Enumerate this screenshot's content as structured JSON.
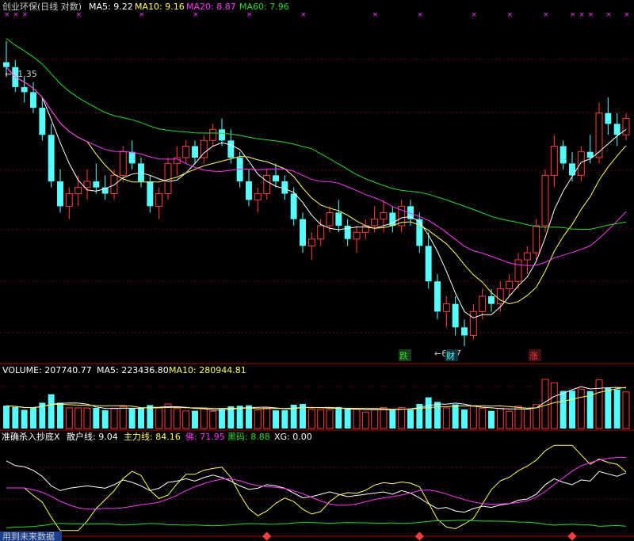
{
  "colors": {
    "background": "#000000",
    "up": "#ff3c3c",
    "down": "#54ffff",
    "ma5": "#ffffff",
    "ma10": "#ffff55",
    "ma20": "#ff33ff",
    "ma60": "#22dd22",
    "grid": "#7a0000",
    "title": "#cccccc"
  },
  "price_panel": {
    "title_stock": "创业环保(日线 对数)",
    "ma_legend": [
      {
        "label": "MA5: 9.22",
        "color": "#ffffff"
      },
      {
        "label": "MA10: 9.16",
        "color": "#ffff55"
      },
      {
        "label": "MA20: 8.87",
        "color": "#ff33ff"
      },
      {
        "label": "MA60: 7.96",
        "color": "#22dd22"
      }
    ],
    "high_marker": "11.35",
    "low_marker": "6.37",
    "signals": [
      {
        "text": "跌",
        "color": "#22dd22"
      },
      {
        "text": "财",
        "color": "#54ffff"
      },
      {
        "text": "涨",
        "color": "#ff3c3c"
      }
    ]
  },
  "volume_panel": {
    "legend": [
      {
        "label": "VOLUME: 207740.77",
        "color": "#ffffff"
      },
      {
        "label": "MA5: 223436.80",
        "color": "#ffffff"
      },
      {
        "label": "MA10: 280944.81",
        "color": "#ffff55"
      }
    ]
  },
  "indicator_panel": {
    "legend": [
      {
        "label": "准确杀入抄底X",
        "color": "#ffffff"
      },
      {
        "label": "散户线: 9.04",
        "color": "#ffffff"
      },
      {
        "label": "主力线: 84.16",
        "color": "#ffff55"
      },
      {
        "label": "佛: 71.95",
        "color": "#ff33ff"
      },
      {
        "label": "黑码: 8.88",
        "color": "#22dd22"
      },
      {
        "label": "XG: 0.00",
        "color": "#ffffff"
      }
    ]
  },
  "footer_text": "用到未来数据",
  "chart_data": {
    "type": "candlestick",
    "title": "创业环保(日线 对数)",
    "ma_periods": [
      5,
      10,
      20,
      60
    ],
    "ma_latest": {
      "MA5": 9.22,
      "MA10": 9.16,
      "MA20": 8.87,
      "MA60": 7.96
    },
    "price_range": [
      6.2,
      11.9
    ],
    "high_label": 11.35,
    "low_label": 6.37,
    "candles_ohlc": [
      [
        10.9,
        11.35,
        10.6,
        10.8
      ],
      [
        10.8,
        10.95,
        10.3,
        10.4
      ],
      [
        10.4,
        10.6,
        10.1,
        10.3
      ],
      [
        10.3,
        10.5,
        9.9,
        10.0
      ],
      [
        10.0,
        10.2,
        9.4,
        9.5
      ],
      [
        9.5,
        9.7,
        8.6,
        8.7
      ],
      [
        8.7,
        8.9,
        8.2,
        8.3
      ],
      [
        8.3,
        8.6,
        8.1,
        8.5
      ],
      [
        8.5,
        8.8,
        8.3,
        8.6
      ],
      [
        8.6,
        8.9,
        8.4,
        8.7
      ],
      [
        8.7,
        9.0,
        8.5,
        8.6
      ],
      [
        8.6,
        8.8,
        8.4,
        8.5
      ],
      [
        8.5,
        8.9,
        8.4,
        8.8
      ],
      [
        8.8,
        9.3,
        8.7,
        9.2
      ],
      [
        9.2,
        9.4,
        8.9,
        9.0
      ],
      [
        9.0,
        9.1,
        8.6,
        8.7
      ],
      [
        8.7,
        8.8,
        8.2,
        8.3
      ],
      [
        8.3,
        8.6,
        8.1,
        8.5
      ],
      [
        8.5,
        9.1,
        8.4,
        9.0
      ],
      [
        9.0,
        9.3,
        8.8,
        9.1
      ],
      [
        9.1,
        9.4,
        9.0,
        9.3
      ],
      [
        9.3,
        9.4,
        9.0,
        9.1
      ],
      [
        9.1,
        9.5,
        9.0,
        9.4
      ],
      [
        9.4,
        9.7,
        9.3,
        9.6
      ],
      [
        9.6,
        9.8,
        9.3,
        9.4
      ],
      [
        9.4,
        9.6,
        9.0,
        9.1
      ],
      [
        9.1,
        9.2,
        8.6,
        8.7
      ],
      [
        8.7,
        8.9,
        8.3,
        8.4
      ],
      [
        8.4,
        8.6,
        8.2,
        8.5
      ],
      [
        8.5,
        8.9,
        8.4,
        8.8
      ],
      [
        8.8,
        9.0,
        8.6,
        8.7
      ],
      [
        8.7,
        8.8,
        8.4,
        8.5
      ],
      [
        8.5,
        8.6,
        8.0,
        8.1
      ],
      [
        8.1,
        8.2,
        7.6,
        7.7
      ],
      [
        7.7,
        7.9,
        7.5,
        7.8
      ],
      [
        7.8,
        8.1,
        7.7,
        8.0
      ],
      [
        8.0,
        8.3,
        7.9,
        8.2
      ],
      [
        8.2,
        8.4,
        7.9,
        8.0
      ],
      [
        8.0,
        8.1,
        7.7,
        7.8
      ],
      [
        7.8,
        8.0,
        7.6,
        7.9
      ],
      [
        7.9,
        8.1,
        7.8,
        8.0
      ],
      [
        8.0,
        8.3,
        7.9,
        8.1
      ],
      [
        8.1,
        8.4,
        7.9,
        8.2
      ],
      [
        8.2,
        8.3,
        7.9,
        8.0
      ],
      [
        8.0,
        8.4,
        7.9,
        8.3
      ],
      [
        8.3,
        8.4,
        8.0,
        8.1
      ],
      [
        8.1,
        8.2,
        7.6,
        7.7
      ],
      [
        7.7,
        7.9,
        7.1,
        7.2
      ],
      [
        7.2,
        7.3,
        6.7,
        6.8
      ],
      [
        6.8,
        7.0,
        6.6,
        6.9
      ],
      [
        6.9,
        7.0,
        6.5,
        6.6
      ],
      [
        6.6,
        6.7,
        6.37,
        6.5
      ],
      [
        6.5,
        6.9,
        6.45,
        6.8
      ],
      [
        6.8,
        7.1,
        6.7,
        7.0
      ],
      [
        7.0,
        7.1,
        6.8,
        6.9
      ],
      [
        6.9,
        7.2,
        6.8,
        7.1
      ],
      [
        7.1,
        7.3,
        7.0,
        7.2
      ],
      [
        7.2,
        7.6,
        7.1,
        7.5
      ],
      [
        7.5,
        7.7,
        7.3,
        7.6
      ],
      [
        7.6,
        8.1,
        7.5,
        8.0
      ],
      [
        8.0,
        8.9,
        7.9,
        8.8
      ],
      [
        8.8,
        9.5,
        8.6,
        9.3
      ],
      [
        9.3,
        9.4,
        8.9,
        9.0
      ],
      [
        9.0,
        9.2,
        8.7,
        8.8
      ],
      [
        8.8,
        9.3,
        8.7,
        9.2
      ],
      [
        9.2,
        9.5,
        9.0,
        9.1
      ],
      [
        9.1,
        10.1,
        9.0,
        9.9
      ],
      [
        9.9,
        10.2,
        9.5,
        9.7
      ],
      [
        9.7,
        9.9,
        9.3,
        9.5
      ],
      [
        9.5,
        9.9,
        9.4,
        9.8
      ]
    ],
    "volume_unit": "lots",
    "volume_latest": 207740.77,
    "volume_ma5": 223436.8,
    "volume_ma10": 280944.81,
    "indicator_series_latest": {
      "散户线": 9.04,
      "主力线": 84.16,
      "佛": 71.95,
      "黑码": 8.88,
      "XG": 0.0
    }
  }
}
